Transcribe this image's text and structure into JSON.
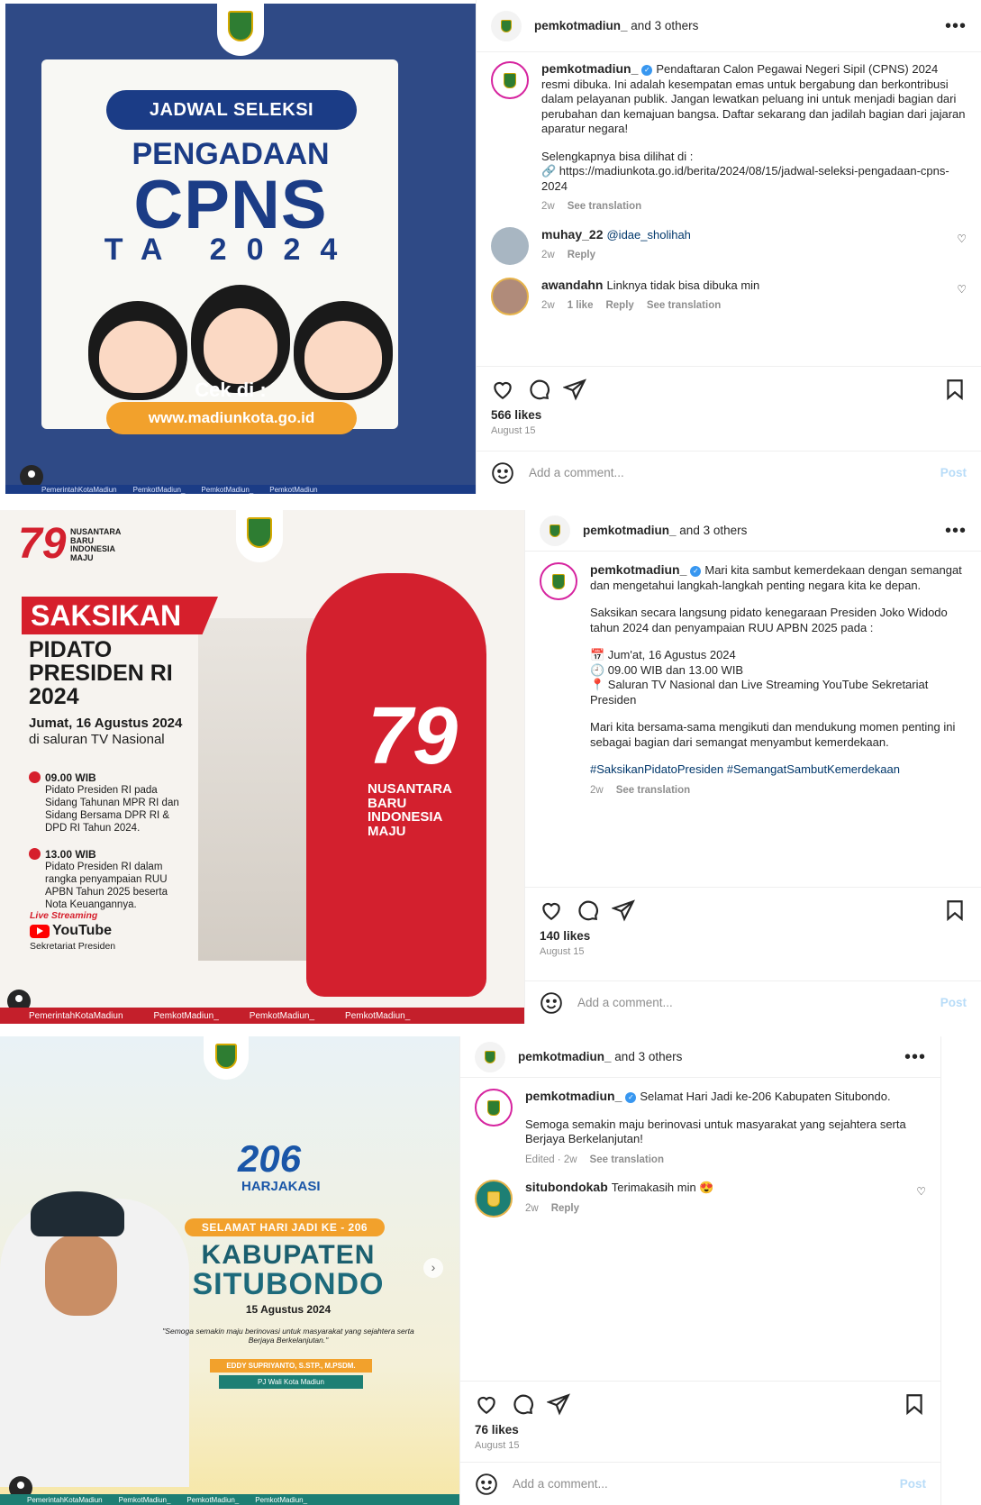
{
  "posts": [
    {
      "header": {
        "name": "pemkotmadiun_",
        "others": "and 3 others"
      },
      "poster": {
        "pill": "JADWAL SELEKSI",
        "line1": "PENGADAAN",
        "line2": "CPNS",
        "line3": "TA 2024",
        "cek": "Cek di :",
        "url": "www.madiunkota.go.id",
        "footer": [
          "PemerintahKotaMadiun",
          "PemkotMadiun_",
          "PemkotMadiun_",
          "PemkotMadiun"
        ]
      },
      "caption": {
        "user": "pemkotmadiun_",
        "p1": "Pendaftaran Calon Pegawai Negeri Sipil (CPNS) 2024 resmi dibuka. Ini adalah kesempatan emas untuk bergabung dan berkontribusi dalam pelayanan publik. Jangan lewatkan peluang ini untuk menjadi bagian dari perubahan dan kemajuan bangsa. Daftar sekarang dan jadilah bagian dari jajaran aparatur negara!",
        "p2": "Selengkapnya bisa dilihat di :",
        "p3": "🔗 https://madiunkota.go.id/berita/2024/08/15/jadwal-seleksi-pengadaan-cpns-2024",
        "time": "2w",
        "translate": "See translation"
      },
      "comments": [
        {
          "user": "muhay_22",
          "text": "@idae_sholihah",
          "time": "2w",
          "reply": "Reply"
        },
        {
          "user": "awandahn",
          "text": "Linknya tidak bisa dibuka min",
          "time": "2w",
          "likes": "1 like",
          "reply": "Reply",
          "translate": "See translation"
        }
      ],
      "likes": "566 likes",
      "date": "August 15",
      "add_comment": "Add a comment...",
      "post_btn": "Post"
    },
    {
      "header": {
        "name": "pemkotmadiun_",
        "others": "and 3 others"
      },
      "poster": {
        "seventy": "79",
        "nbim": [
          "NUSANTARA",
          "BARU",
          "INDONESIA",
          "MAJU"
        ],
        "banner": "SAKSIKAN",
        "big": [
          "PIDATO",
          "PRESIDEN RI",
          "2024"
        ],
        "sub1": "Jumat, 16 Agustus 2024",
        "sub2": "di saluran TV Nasional",
        "b1_time": "09.00 WIB",
        "b1_text": "Pidato Presiden RI pada Sidang Tahunan MPR RI dan Sidang Bersama DPR RI & DPD RI Tahun 2024.",
        "b2_time": "13.00 WIB",
        "b2_text": "Pidato Presiden RI dalam rangka penyampaian RUU APBN Tahun 2025 beserta Nota Keuangannya.",
        "live": "Live Streaming",
        "youtube": "YouTube",
        "sekr": "Sekretariat Presiden",
        "nusa": [
          "NUSANTARA",
          "BARU",
          "INDONESIA",
          "MAJU"
        ],
        "footer": [
          "PemerintahKotaMadiun",
          "PemkotMadiun_",
          "PemkotMadiun_",
          "PemkotMadiun_"
        ]
      },
      "caption": {
        "user": "pemkotmadiun_",
        "p1": "Mari kita sambut kemerdekaan dengan semangat dan mengetahui langkah-langkah penting negara kita ke depan.",
        "p2": "Saksikan secara langsung pidato kenegaraan Presiden Joko Widodo tahun 2024 dan penyampaian RUU APBN 2025 pada :",
        "l1": "📅 Jum'at, 16 Agustus 2024",
        "l2": "🕘 09.00 WIB dan 13.00 WIB",
        "l3": "📍 Saluran TV Nasional dan Live Streaming YouTube Sekretariat Presiden",
        "p3": "Mari kita bersama-sama mengikuti dan mendukung momen penting ini sebagai bagian dari semangat menyambut kemerdekaan.",
        "tags": "#SaksikanPidatoPresiden #SemangatSambutKemerdekaan",
        "time": "2w",
        "translate": "See translation"
      },
      "likes": "140 likes",
      "date": "August 15",
      "add_comment": "Add a comment...",
      "post_btn": "Post"
    },
    {
      "header": {
        "name": "pemkotmadiun_",
        "others": "and 3 others"
      },
      "poster": {
        "n206": "206",
        "harj": "HARJAKASI",
        "ban": "SELAMAT HARI JADI KE - 206",
        "kab": "KABUPATEN",
        "sit": "SITUBONDO",
        "date": "15 Agustus 2024",
        "quote": "\"Semoga semakin maju berinovasi untuk masyarakat yang sejahtera serta Berjaya Berkelanjutan.\"",
        "name": "EDDY SUPRIYANTO, S.STP., M.PSDM.",
        "role": "PJ Wali Kota Madiun",
        "footer": [
          "PemerintahKotaMadiun",
          "PemkotMadiun_",
          "PemkotMadiun_",
          "PemkotMadiun_"
        ]
      },
      "caption": {
        "user": "pemkotmadiun_",
        "p1": "Selamat Hari Jadi ke-206 Kabupaten Situbondo.",
        "p2": "Semoga semakin maju berinovasi untuk masyarakat yang sejahtera serta Berjaya Berkelanjutan!",
        "edited": "Edited · 2w",
        "translate": "See translation"
      },
      "comments": [
        {
          "user": "situbondokab",
          "text": "Terimakasih min 😍",
          "time": "2w",
          "reply": "Reply"
        }
      ],
      "likes": "76 likes",
      "date": "August 15",
      "add_comment": "Add a comment...",
      "post_btn": "Post"
    }
  ]
}
